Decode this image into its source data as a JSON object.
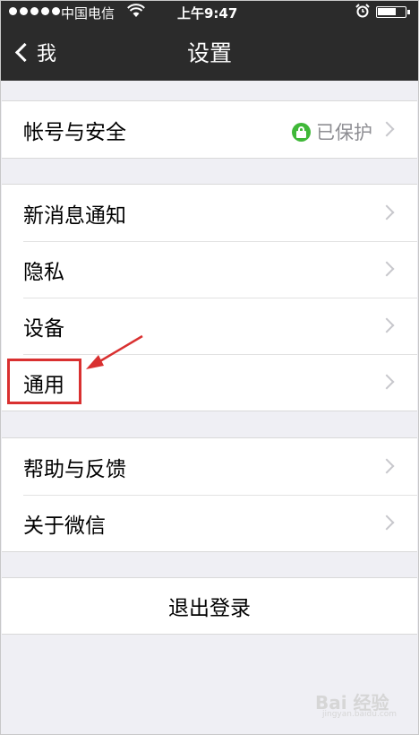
{
  "status_bar": {
    "carrier": "中国电信",
    "time": "上午9:47",
    "wifi_icon": "wifi-icon",
    "alarm_icon": "alarm-icon"
  },
  "nav": {
    "back_label": "我",
    "title": "设置"
  },
  "account_row": {
    "label": "帐号与安全",
    "status": "已保护"
  },
  "group2": [
    {
      "label": "新消息通知"
    },
    {
      "label": "隐私"
    },
    {
      "label": "设备"
    },
    {
      "label": "通用"
    }
  ],
  "group3": [
    {
      "label": "帮助与反馈"
    },
    {
      "label": "关于微信"
    }
  ],
  "logout": {
    "label": "退出登录"
  },
  "annotation": {
    "color": "#d93030"
  },
  "watermark": {
    "text": "Bai 经验",
    "sub": "jingyan.baidu.com"
  },
  "colors": {
    "nav_bg": "#2b2b2b",
    "page_bg": "#efeff4",
    "lock_green": "#3fb838"
  }
}
